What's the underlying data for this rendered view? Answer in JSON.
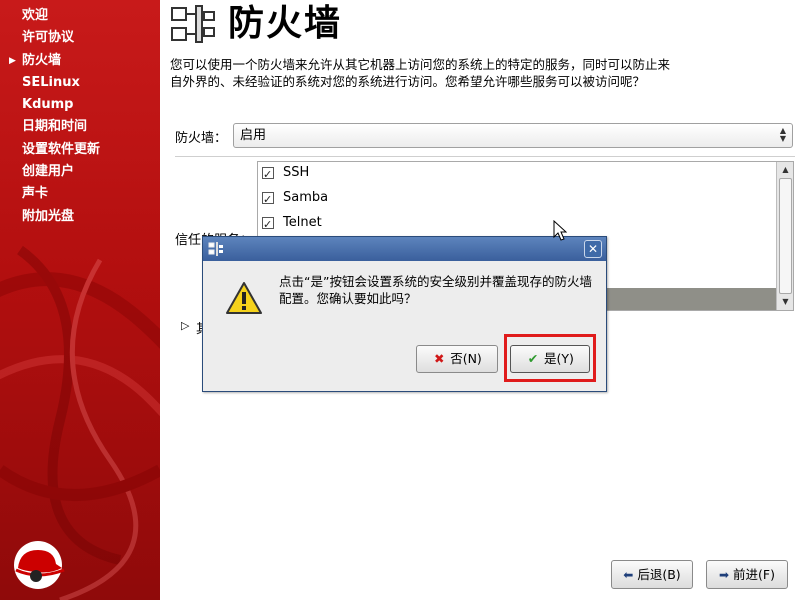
{
  "sidebar": {
    "items": [
      {
        "label": "欢迎"
      },
      {
        "label": "许可协议"
      },
      {
        "label": "防火墙",
        "current": true
      },
      {
        "label": "SELinux"
      },
      {
        "label": "Kdump"
      },
      {
        "label": "日期和时间"
      },
      {
        "label": "设置软件更新"
      },
      {
        "label": "创建用户"
      },
      {
        "label": "声卡"
      },
      {
        "label": "附加光盘"
      }
    ]
  },
  "header": {
    "title": "防火墙",
    "description": "您可以使用一个防火墙来允许从其它机器上访问您的系统上的特定的服务，同时可以防止来自外界的、未经验证的系统对您的系统进行访问。您希望允许哪些服务可以被访问呢？"
  },
  "firewall": {
    "label": "防火墙：",
    "value": "启用"
  },
  "services": {
    "label": "信任的服务：",
    "items": [
      {
        "name": "SSH",
        "checked": true
      },
      {
        "name": "Samba",
        "checked": true
      },
      {
        "name": "Telnet",
        "checked": true
      }
    ]
  },
  "expander": {
    "label": "其"
  },
  "dialog": {
    "message": "点击“是”按钮会设置系统的安全级别并覆盖现存的防火墙配置。您确认要如此吗？",
    "no_label": "否(N)",
    "yes_label": "是(Y)",
    "close_glyph": "✕"
  },
  "nav": {
    "back_label": "后退(B)",
    "next_label": "前进(F)"
  },
  "colors": {
    "sidebar_red": "#b30f0f",
    "dialog_title_blue": "#3a5f9c",
    "highlight_red": "#e01b1b"
  },
  "icons": {
    "warning": "warning-icon",
    "firewall": "firewall-icon",
    "no": "cross-icon",
    "yes": "check-icon",
    "back": "arrow-left-icon",
    "next": "arrow-right-icon"
  }
}
